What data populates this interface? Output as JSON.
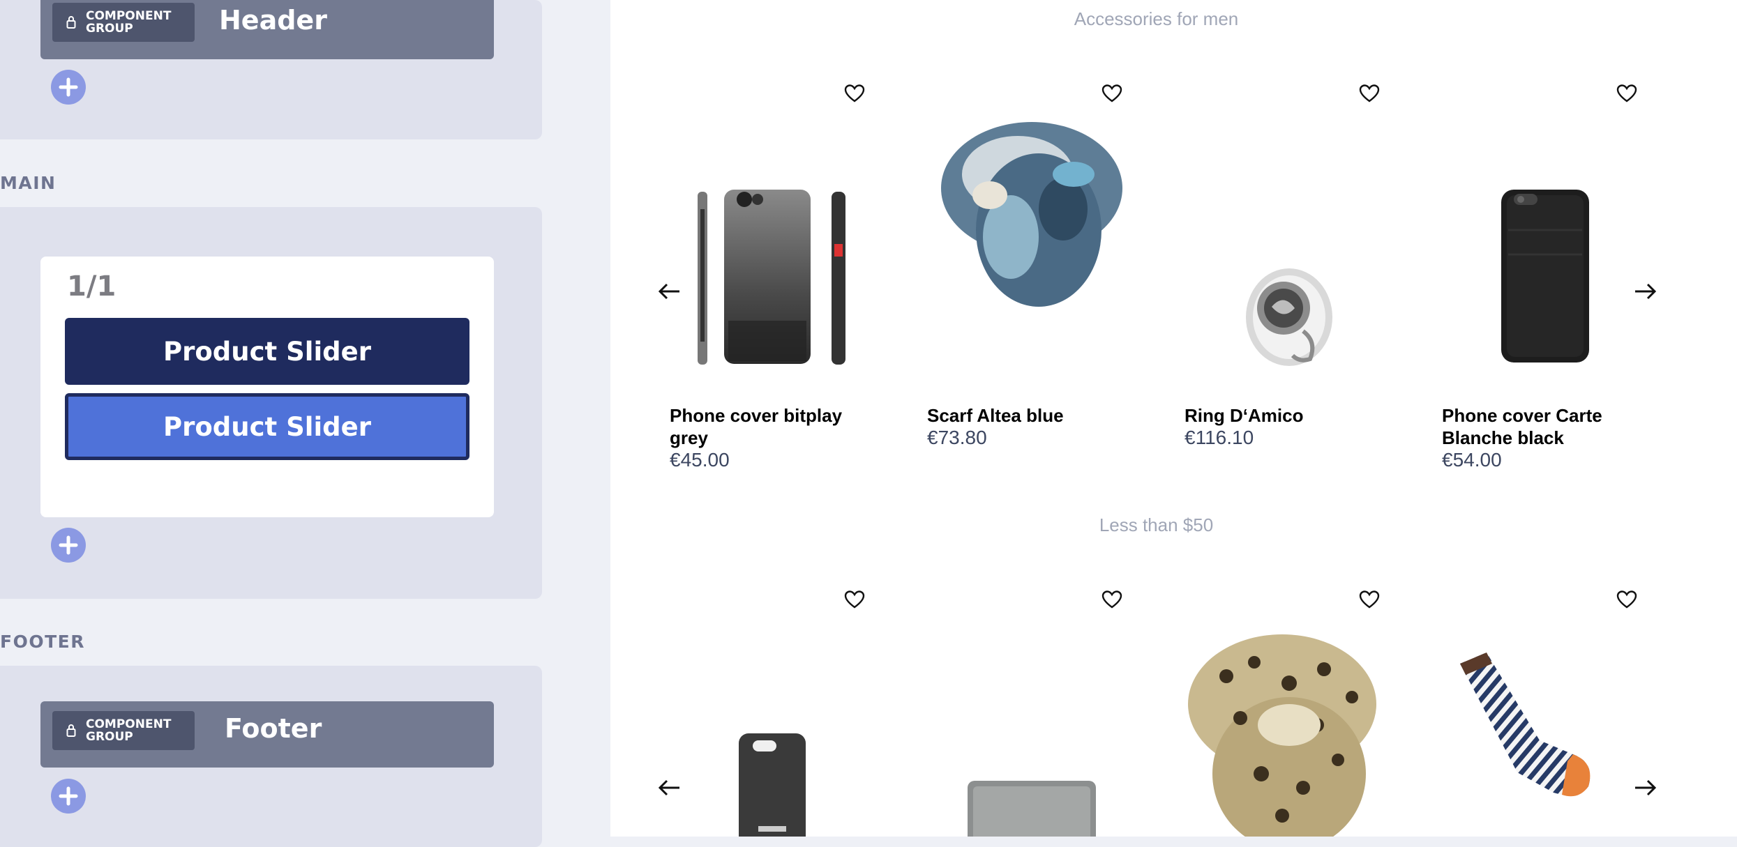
{
  "editor": {
    "header_section": {
      "badge_label": "COMPONENT\nGROUP",
      "title": "Header"
    },
    "main_section": {
      "label": "MAIN",
      "block_count": "1/1",
      "blocks": [
        "Product Slider",
        "Product Slider"
      ]
    },
    "footer_section": {
      "label": "FOOTER",
      "badge_label": "COMPONENT\nGROUP",
      "title": "Footer"
    },
    "colors": {
      "panel": "#dfe1ed",
      "group_bar": "#737a91",
      "block_dark": "#1f2b5e",
      "block_active": "#4f72d9",
      "add_button": "#8b99e3"
    }
  },
  "preview": {
    "sliders": [
      {
        "title": "Accessories for men",
        "products": [
          {
            "name": "Phone cover bitplay grey",
            "price": "€45.00",
            "image": "phone-cover-grey"
          },
          {
            "name": "Scarf Altea blue",
            "price": "€73.80",
            "image": "scarf-blue"
          },
          {
            "name": "Ring D‘Amico",
            "price": "€116.10",
            "image": "silver-ring"
          },
          {
            "name": "Phone cover Carte Blanche black",
            "price": "€54.00",
            "image": "phone-cover-black"
          }
        ]
      },
      {
        "title": "Less than $50",
        "products": [
          {
            "name": "",
            "price": "",
            "image": "phone-cover-dark"
          },
          {
            "name": "",
            "price": "",
            "image": "grey-wallet"
          },
          {
            "name": "",
            "price": "",
            "image": "leopard-scarf"
          },
          {
            "name": "",
            "price": "",
            "image": "striped-sock"
          }
        ]
      }
    ]
  }
}
